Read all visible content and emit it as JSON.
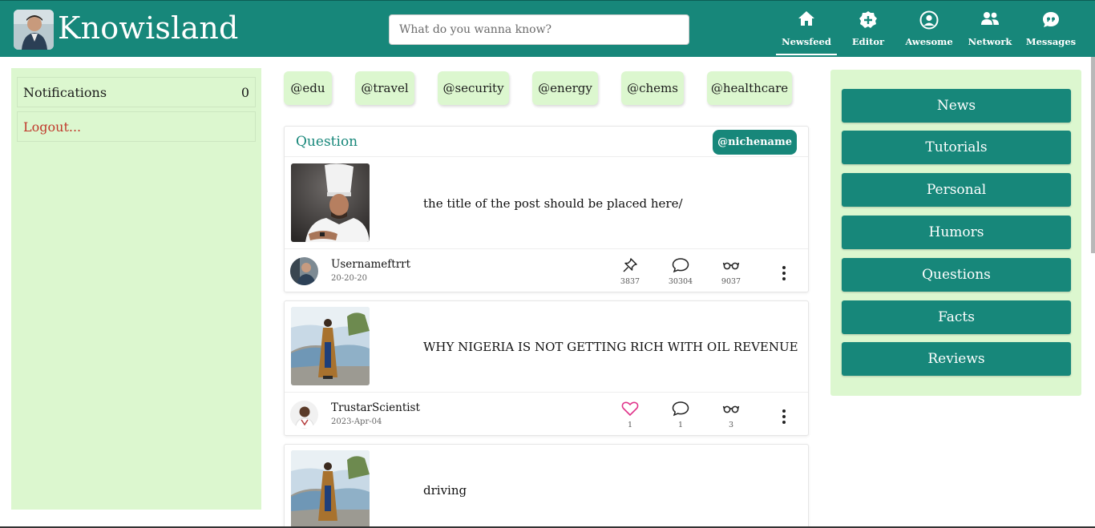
{
  "header": {
    "brand": "Knowisland",
    "search_placeholder": "What do you wanna know?",
    "nav": [
      {
        "label": "Newsfeed",
        "icon": "home-icon",
        "active": true
      },
      {
        "label": "Editor",
        "icon": "plus-badge-icon",
        "active": false
      },
      {
        "label": "Awesome",
        "icon": "user-circle-icon",
        "active": false
      },
      {
        "label": "Network",
        "icon": "users-icon",
        "active": false
      },
      {
        "label": "Messages",
        "icon": "quote-bubble-icon",
        "active": false
      }
    ]
  },
  "left": {
    "notifications_label": "Notifications",
    "notifications_count": "0",
    "logout_label": "Logout..."
  },
  "tags": [
    "@edu",
    "@travel",
    "@security",
    "@energy",
    "@chems",
    "@healthcare"
  ],
  "question": {
    "label": "Question",
    "niche": "@nichename"
  },
  "posts": [
    {
      "title": "the title of the post should be placed here/",
      "username": "Usernameftrrt",
      "date": "20-20-20",
      "first_stat_icon": "pin-icon",
      "first_stat": "3837",
      "comments": "30304",
      "views": "9037"
    },
    {
      "title": "WHY NIGERIA IS NOT GETTING RICH WITH OIL REVENUE",
      "username": "TrustarScientist",
      "date": "2023-Apr-04",
      "first_stat_icon": "heart-icon",
      "first_stat": "1",
      "comments": "1",
      "views": "3"
    },
    {
      "title": "driving"
    }
  ],
  "categories": [
    "News",
    "Tutorials",
    "Personal",
    "Humors",
    "Questions",
    "Facts",
    "Reviews"
  ],
  "colors": {
    "brand": "#17877a",
    "panel": "#dcf7cf",
    "logout": "#c0392b",
    "heart": "#e0338a"
  }
}
